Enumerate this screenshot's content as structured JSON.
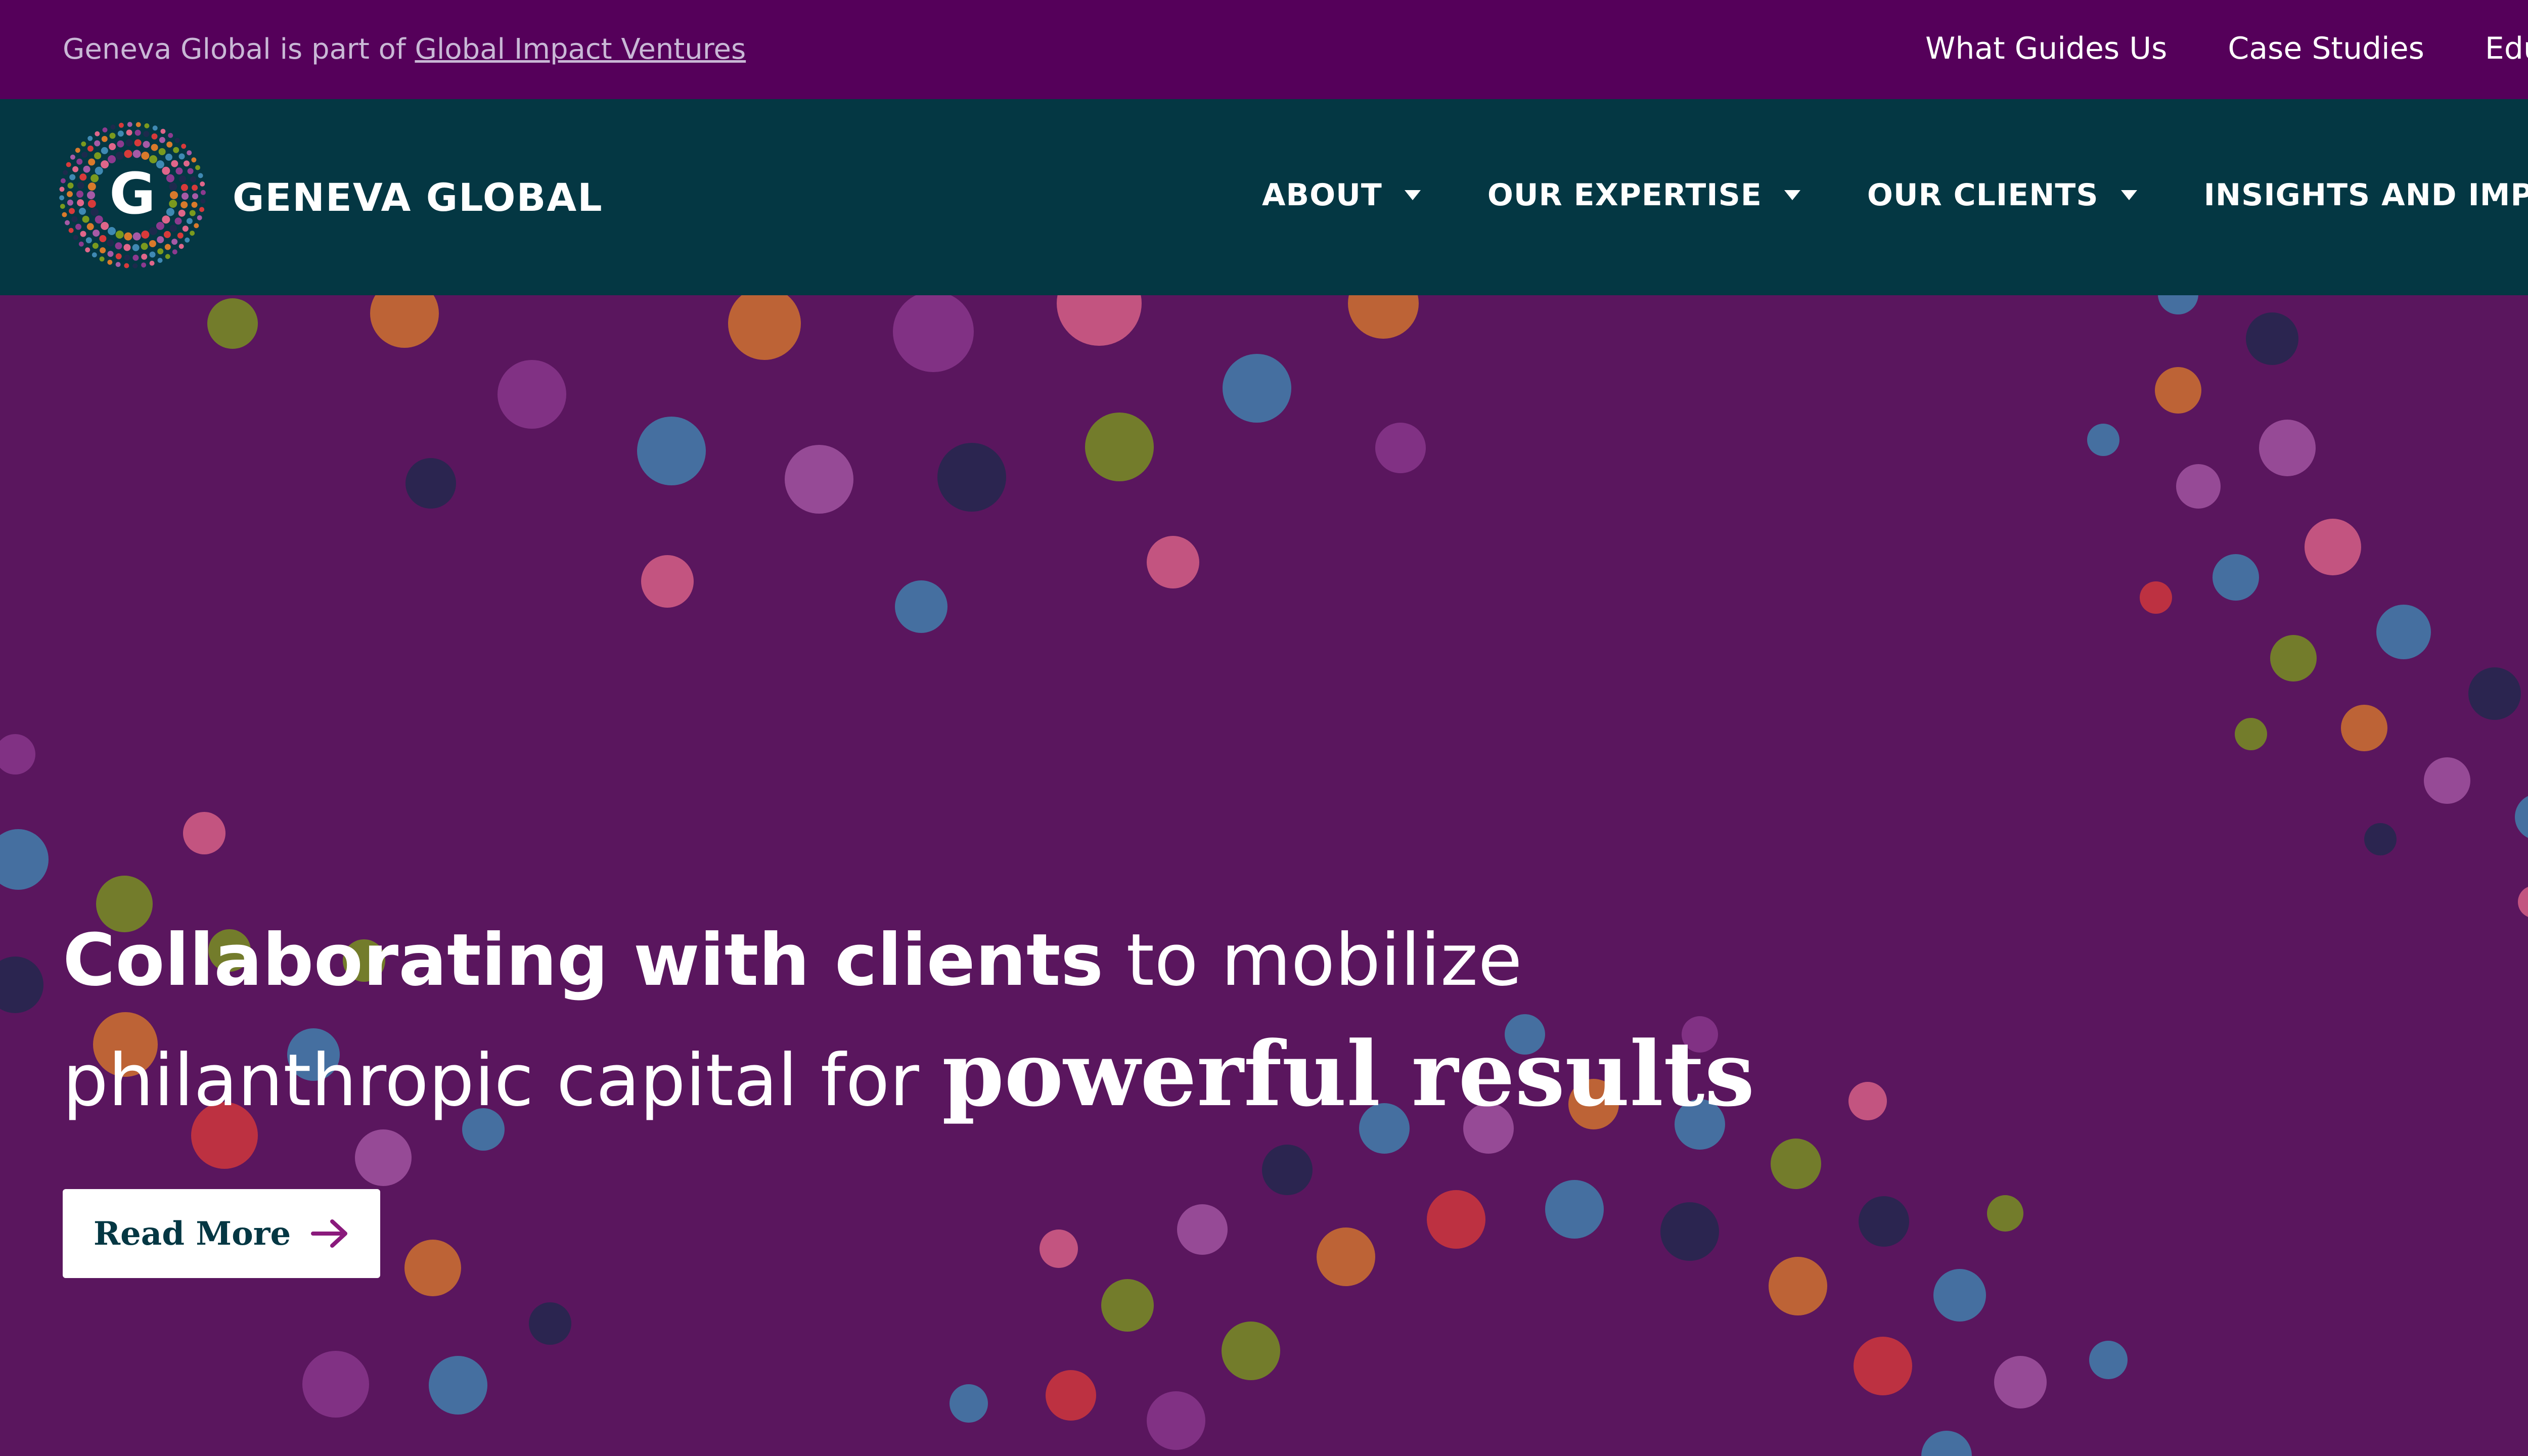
{
  "topbar": {
    "parent_prefix": "Geneva Global is part of ",
    "parent_link": "Global Impact Ventures",
    "links": [
      "What Guides Us",
      "Case Studies",
      "Educat"
    ]
  },
  "navbar": {
    "logo_letter": "G",
    "logo_text": "GENEVA GLOBAL",
    "menu": [
      {
        "label": "ABOUT",
        "icon": "chevron-down-icon"
      },
      {
        "label": "OUR EXPERTISE",
        "icon": "chevron-down-icon"
      },
      {
        "label": "OUR CLIENTS",
        "icon": "chevron-down-icon"
      },
      {
        "label": "INSIGHTS AND IMPACT",
        "icon": "chevron-down-icon"
      }
    ]
  },
  "hero": {
    "headline": {
      "bold1": "Collaborating with clients",
      "rest1": " to mobilize",
      "rest2": "philanthropic capital for ",
      "emph": "powerful results"
    },
    "cta_label": "Read More",
    "cta_icon": "arrow-right-icon"
  },
  "colors": {
    "topbar_bg": "#55005a",
    "nav_bg": "#043743",
    "hero_bg": "#5a165e",
    "cta_text": "#043743",
    "cta_arrow": "#8a1a7c",
    "dot_palette": [
      "#d97a2b",
      "#7a9a1e",
      "#3f89b3",
      "#e0668a",
      "#8c3a8f",
      "#1d2a4d",
      "#d83a3a",
      "#a65aa6"
    ]
  }
}
